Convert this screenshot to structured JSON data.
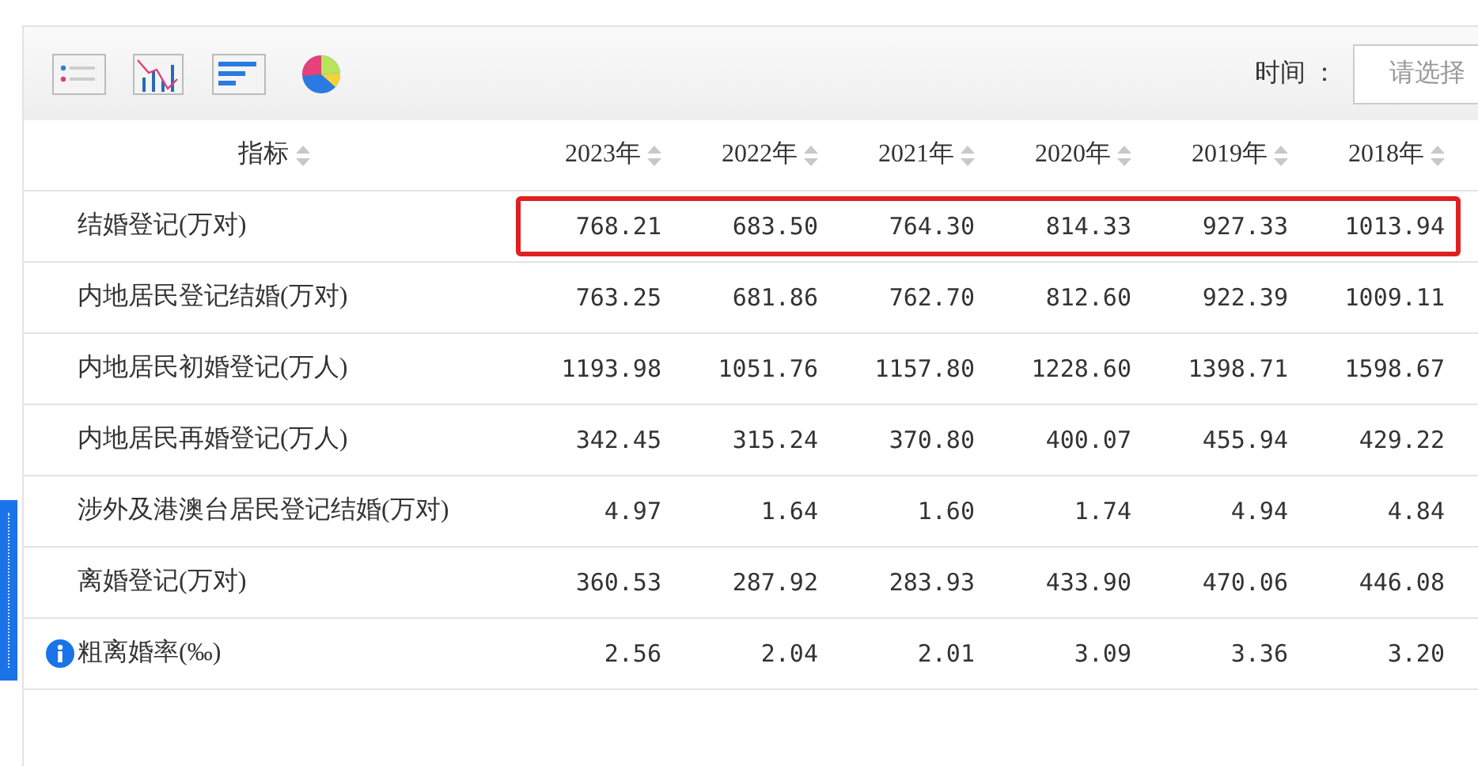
{
  "toolbar": {
    "time_label": "时间 ：",
    "time_field": {
      "placeholder": "请选择"
    }
  },
  "table": {
    "columns": [
      {
        "label": "指标"
      },
      {
        "label": "2023年"
      },
      {
        "label": "2022年"
      },
      {
        "label": "2021年"
      },
      {
        "label": "2020年"
      },
      {
        "label": "2019年"
      },
      {
        "label": "2018年"
      }
    ],
    "rows": [
      {
        "label": "结婚登记(万对)",
        "highlighted": true,
        "info_icon": false,
        "values": [
          "768.21",
          "683.50",
          "764.30",
          "814.33",
          "927.33",
          "1013.94"
        ]
      },
      {
        "label": "内地居民登记结婚(万对)",
        "highlighted": false,
        "info_icon": false,
        "values": [
          "763.25",
          "681.86",
          "762.70",
          "812.60",
          "922.39",
          "1009.11"
        ]
      },
      {
        "label": "内地居民初婚登记(万人)",
        "highlighted": false,
        "info_icon": false,
        "values": [
          "1193.98",
          "1051.76",
          "1157.80",
          "1228.60",
          "1398.71",
          "1598.67"
        ]
      },
      {
        "label": "内地居民再婚登记(万人)",
        "highlighted": false,
        "info_icon": false,
        "values": [
          "342.45",
          "315.24",
          "370.80",
          "400.07",
          "455.94",
          "429.22"
        ]
      },
      {
        "label": "涉外及港澳台居民登记结婚(万对)",
        "highlighted": false,
        "info_icon": false,
        "values": [
          "4.97",
          "1.64",
          "1.60",
          "1.74",
          "4.94",
          "4.84"
        ]
      },
      {
        "label": "离婚登记(万对)",
        "highlighted": false,
        "info_icon": false,
        "values": [
          "360.53",
          "287.92",
          "283.93",
          "433.90",
          "470.06",
          "446.08"
        ]
      },
      {
        "label": "粗离婚率(‰)",
        "highlighted": false,
        "info_icon": true,
        "values": [
          "2.56",
          "2.04",
          "2.01",
          "3.09",
          "3.36",
          "3.20"
        ]
      }
    ]
  }
}
